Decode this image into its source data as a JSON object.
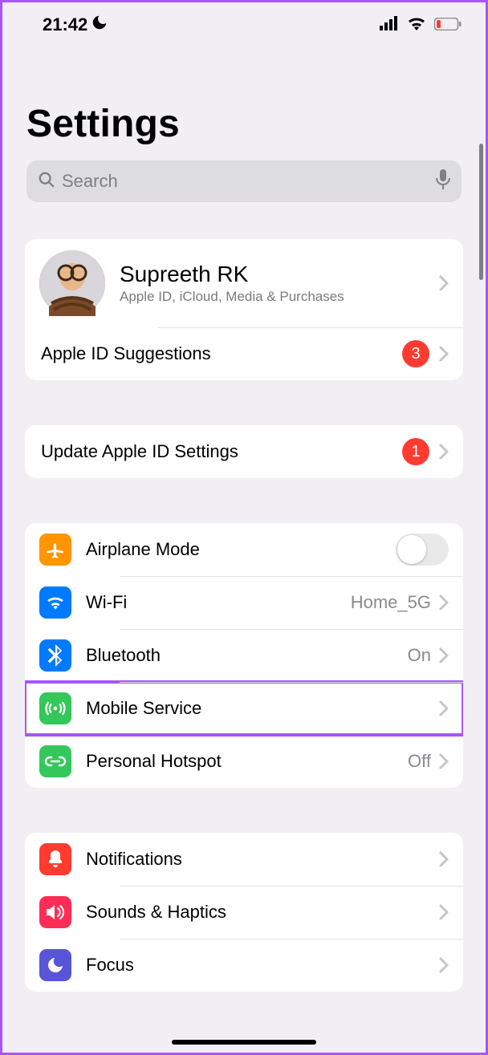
{
  "status": {
    "time": "21:42"
  },
  "title": "Settings",
  "search": {
    "placeholder": "Search"
  },
  "profile": {
    "name": "Supreeth RK",
    "subtitle": "Apple ID, iCloud, Media & Purchases",
    "suggestions_label": "Apple ID Suggestions",
    "suggestions_badge": "3"
  },
  "update": {
    "label": "Update Apple ID Settings",
    "badge": "1"
  },
  "network": {
    "airplane": {
      "label": "Airplane Mode",
      "on": false
    },
    "wifi": {
      "label": "Wi-Fi",
      "value": "Home_5G"
    },
    "bluetooth": {
      "label": "Bluetooth",
      "value": "On"
    },
    "mobile": {
      "label": "Mobile Service"
    },
    "hotspot": {
      "label": "Personal Hotspot",
      "value": "Off"
    }
  },
  "general": {
    "notifications": {
      "label": "Notifications"
    },
    "sounds": {
      "label": "Sounds & Haptics"
    },
    "focus": {
      "label": "Focus"
    }
  }
}
